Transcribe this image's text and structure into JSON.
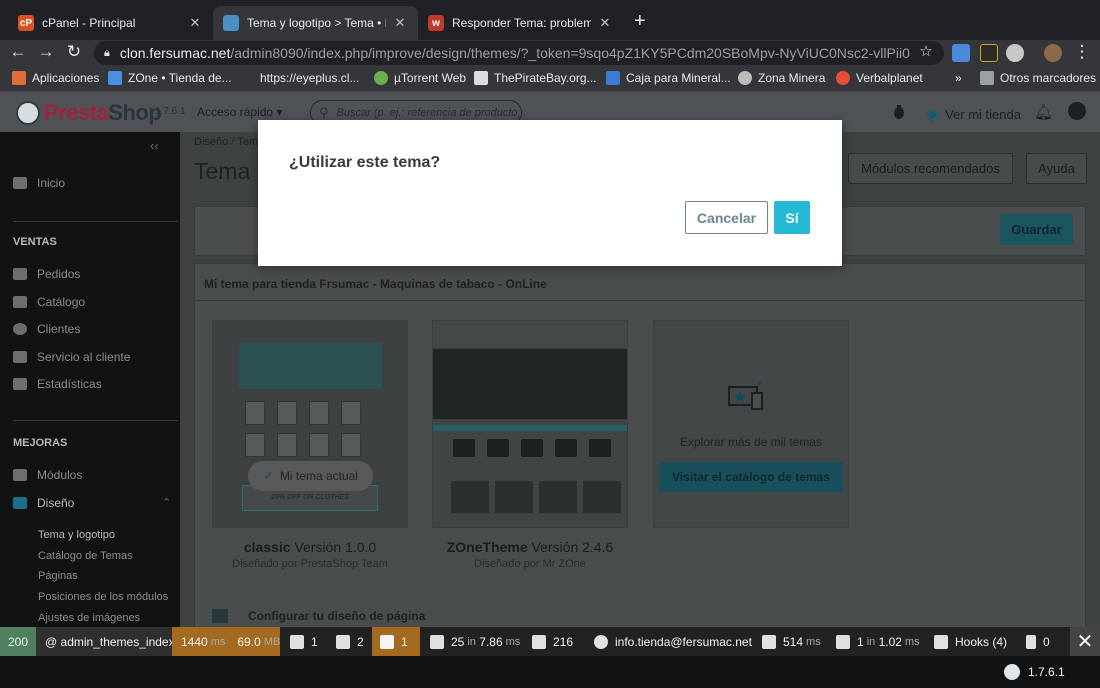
{
  "browser": {
    "tabs": [
      {
        "title": "cPanel - Principal",
        "favicon": "cpanel-icon",
        "active": false
      },
      {
        "title": "Tema y logotipo > Tema • Fersu",
        "favicon": "page-icon",
        "active": true
      },
      {
        "title": "Responder Tema: problemas co",
        "favicon": "forum-icon",
        "active": false
      }
    ],
    "url_host": "clon.fersumac.net",
    "url_path": "/admin8090/index.php/improve/design/themes/?_token=9sqo4pZ1KY5PCdm20SBoMpv-NyViUC0Nsc2-vllPii0",
    "bookmarks": [
      "Aplicaciones",
      "ZOne • Tienda de...",
      "https://eyeplus.cl...",
      "µTorrent Web",
      "ThePirateBay.org...",
      "Caja para Mineral...",
      "Zona Minera",
      "Verbalplanet"
    ],
    "bookmarks_more": "»",
    "other_bookmarks": "Otros marcadores"
  },
  "ps": {
    "logo_pre": "Presta",
    "logo_post": "Shop",
    "version": "1.7.6.1",
    "quick_access": "Acceso rápido ▾",
    "search_placeholder": "Buscar (p. ej.: referencia de producto, n",
    "view_store": "Ver mi tienda"
  },
  "sidebar": {
    "collapse": "‹‹",
    "home": "Inicio",
    "sec_sales": "VENTAS",
    "sales": [
      "Pedidos",
      "Catálogo",
      "Clientes",
      "Servicio al cliente",
      "Estadísticas"
    ],
    "sec_improve": "MEJORAS",
    "modules": "Módulos",
    "design": "Diseño",
    "design_chev": "⌃",
    "design_sub": [
      "Tema y logotipo",
      "Catálogo de Temas",
      "Páginas",
      "Posiciones de los módulos",
      "Ajustes de imágenes"
    ]
  },
  "content": {
    "breadcrumb": "Diseño  /  Tem",
    "title": "Tema",
    "btn_recommended": "Módulos recomendados",
    "btn_help": "Ayuda",
    "btn_save": "Guardar",
    "panel_title": "Mi tema para tienda Frsumac - Maquinas de tabaco - OnLine",
    "current_theme_badge": "Mi tema actual",
    "banner_text": "20% OFF ON CLOTHES",
    "themes": [
      {
        "name": "classic",
        "version": "Versión 1.0.0",
        "author": "Diseñado por PrestaShop Team"
      },
      {
        "name": "ZOneTheme",
        "version": "Versión 2.4.6",
        "author": "Diseñado por Mr ZOne"
      }
    ],
    "explore_text": "Explorar más de mil temas",
    "explore_btn": "Visitar el catálogo de temas",
    "config_label": "Configurar tu diseño de página"
  },
  "modal": {
    "title": "¿Utilizar este tema?",
    "cancel": "Cancelar",
    "yes": "Sí"
  },
  "debug": {
    "status": "200",
    "route": "@ admin_themes_index",
    "time": "1440",
    "time_unit": "ms",
    "memory": "69.0",
    "memory_unit": "MB",
    "forms": "1",
    "logs": "2",
    "warnings": "1",
    "queries": "25",
    "queries_mid": "in",
    "queries_time": "7.86",
    "queries_unit": "ms",
    "translations": "216",
    "user": "info.tienda@fersumac.net",
    "render_time": "514",
    "render_unit": "ms",
    "cache_calls": "1",
    "cache_mid": "in",
    "cache_time": "1.02",
    "cache_unit": "ms",
    "hooks": "Hooks (4)",
    "module_count": "0",
    "close": "✕",
    "ps_version": "1.7.6.1"
  },
  "colors": {
    "accent": "#25b9d7",
    "modal_cancel": "#6c868e",
    "debug_ok": "#4f805d",
    "debug_warn": "#a46a1f"
  }
}
